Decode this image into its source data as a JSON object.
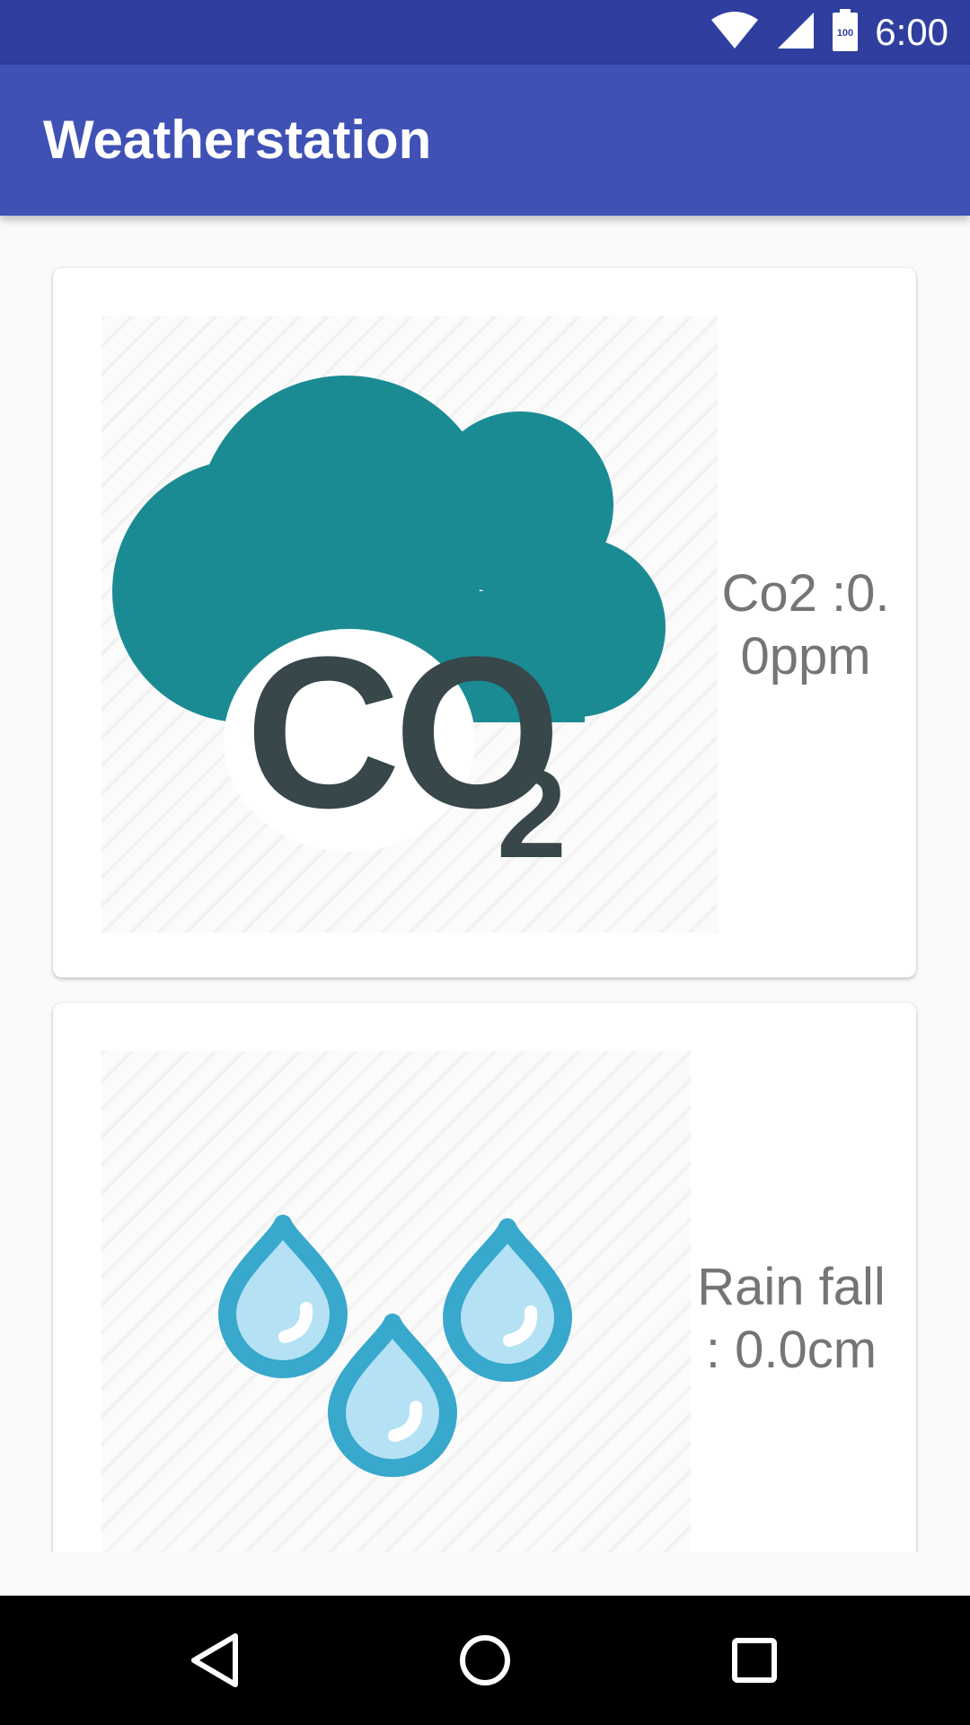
{
  "status_bar": {
    "time": "6:00",
    "battery_level": "100",
    "icons": [
      "wifi-icon",
      "cellular-signal-icon",
      "battery-icon"
    ],
    "color": "#303f9f"
  },
  "app_bar": {
    "title": "Weatherstation",
    "color": "#3f51b5"
  },
  "cards": [
    {
      "icon": "co2-cloud-icon",
      "icon_text": "CO",
      "icon_subscript": "2",
      "reading": "Co2 :0.0ppm",
      "icon_colors": {
        "cloud": "#1b8b93",
        "text": "#37474a"
      }
    },
    {
      "icon": "rain-drops-icon",
      "reading": "Rain fall : 0.0cm",
      "icon_colors": {
        "outline": "#38a8cd",
        "fill": "#b5e1f4"
      }
    }
  ],
  "nav_bar": {
    "buttons": [
      "back-icon",
      "home-icon",
      "recents-icon"
    ]
  },
  "colors": {
    "background": "#fafafa",
    "card": "#ffffff",
    "reading_text": "#757575"
  }
}
